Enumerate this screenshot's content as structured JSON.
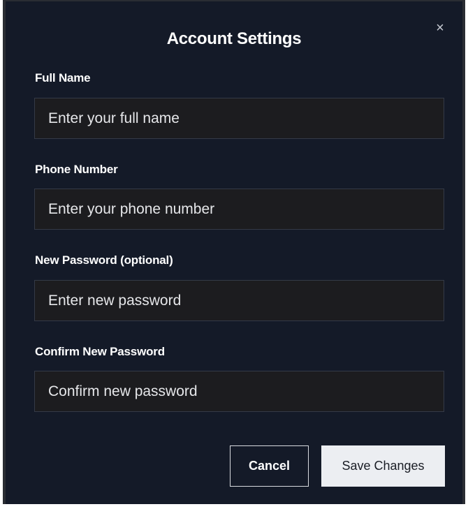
{
  "dialog": {
    "title": "Account Settings",
    "close_icon": "close-icon",
    "close_glyph": "×"
  },
  "fields": [
    {
      "label": "Full Name",
      "value": "",
      "placeholder": "Enter your full name"
    },
    {
      "label": "Phone Number",
      "value": "",
      "placeholder": "Enter your phone number"
    },
    {
      "label": "New Password (optional)",
      "value": "",
      "placeholder": "Enter new password"
    },
    {
      "label": "Confirm New Password",
      "value": "",
      "placeholder": "Confirm new password"
    }
  ],
  "actions": {
    "cancel_label": "Cancel",
    "save_label": "Save Changes"
  },
  "colors": {
    "dialog_background": "#141a28",
    "input_background": "#1c1c1f",
    "primary_button": "#eceef2"
  }
}
